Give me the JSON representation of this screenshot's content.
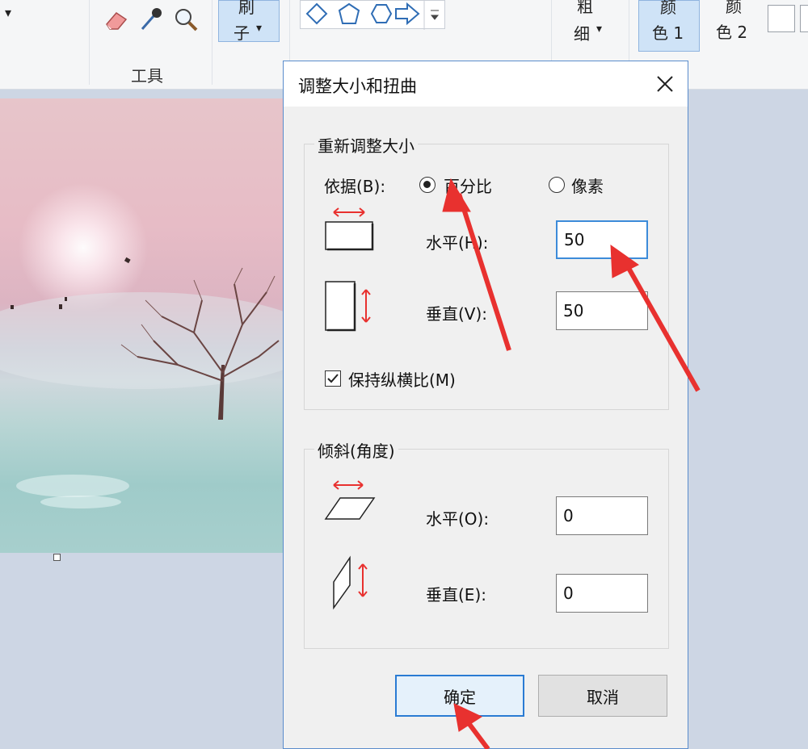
{
  "ribbon": {
    "tools_label": "工具",
    "brush_label_top": "刷",
    "brush_label_bottom": "子",
    "size_label_top": "粗",
    "size_label_bottom": "细",
    "color1_top": "颜",
    "color1_bottom": "色 1",
    "color2_top": "颜",
    "color2_bottom": "色 2",
    "dropdown_arrow": "▾"
  },
  "dialog": {
    "title": "调整大小和扭曲",
    "close_glyph": "✕",
    "resize": {
      "group_title": "重新调整大小",
      "by_label": "依据(B):",
      "percent_label": "百分比",
      "pixels_label": "像素",
      "selected_mode": "percent",
      "horizontal_label": "水平(H):",
      "horizontal_value": "50",
      "vertical_label": "垂直(V):",
      "vertical_value": "50",
      "keep_ratio_label": "保持纵横比(M)",
      "keep_ratio_checked": true
    },
    "skew": {
      "group_title": "倾斜(角度)",
      "horizontal_label": "水平(O):",
      "horizontal_value": "0",
      "vertical_label": "垂直(E):",
      "vertical_value": "0"
    },
    "ok_label": "确定",
    "cancel_label": "取消"
  },
  "colors": {
    "accent_blue": "#3c8bd9",
    "annotation_red": "#e8312f"
  }
}
